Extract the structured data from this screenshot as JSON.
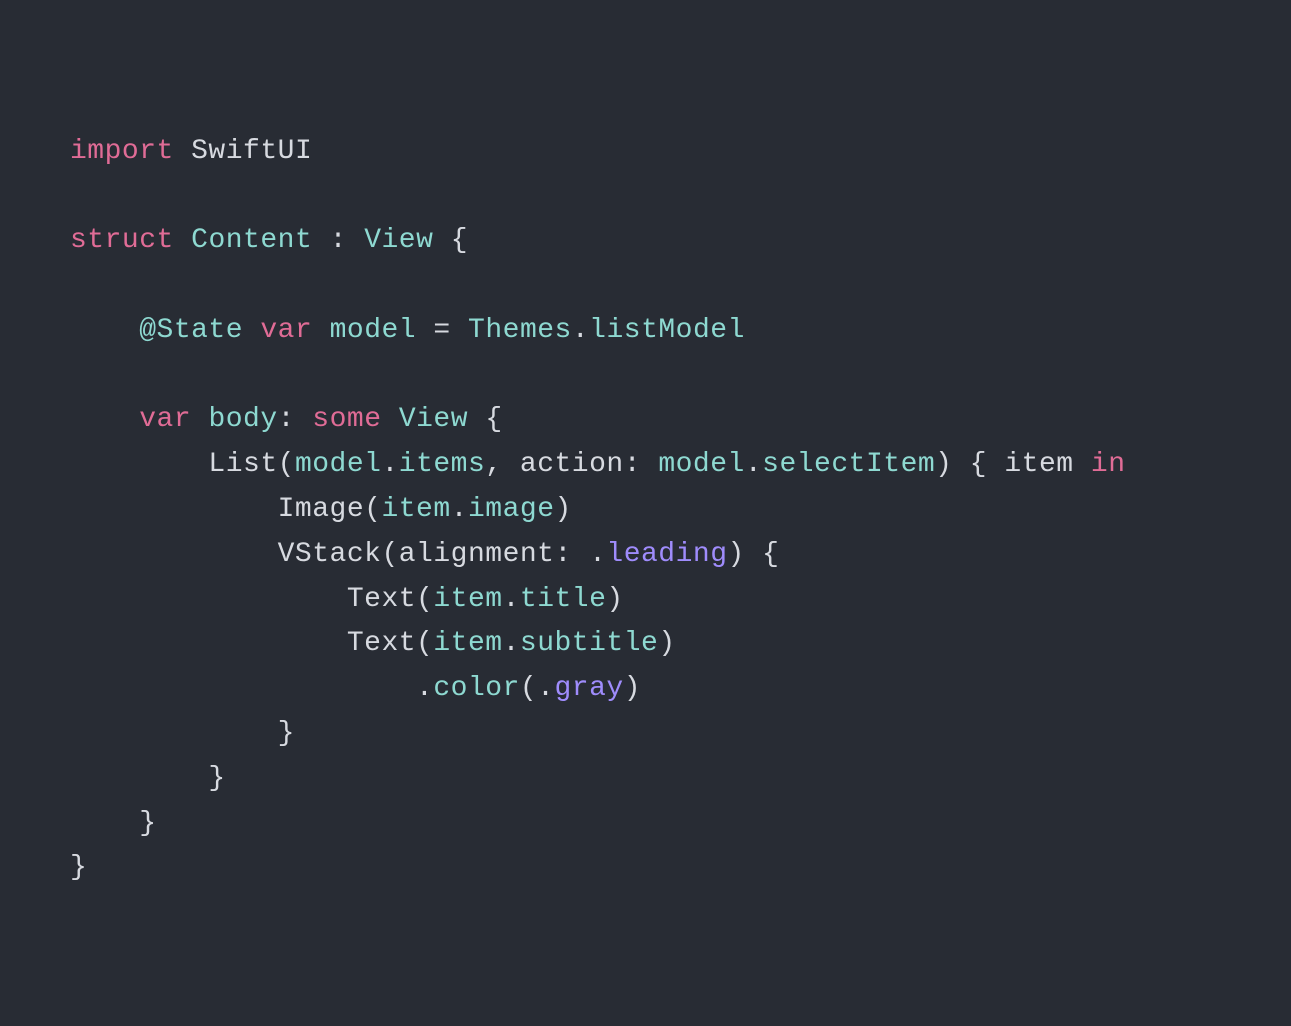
{
  "tokens": [
    [
      {
        "t": "import",
        "c": "keyword"
      },
      {
        "t": " SwiftUI",
        "c": "default"
      }
    ],
    [],
    [
      {
        "t": "struct",
        "c": "keyword"
      },
      {
        "t": " ",
        "c": "default"
      },
      {
        "t": "Content",
        "c": "type"
      },
      {
        "t": " : ",
        "c": "default"
      },
      {
        "t": "View",
        "c": "type"
      },
      {
        "t": " {",
        "c": "default"
      }
    ],
    [],
    [
      {
        "t": "    ",
        "c": "default"
      },
      {
        "t": "@State",
        "c": "type"
      },
      {
        "t": " ",
        "c": "default"
      },
      {
        "t": "var",
        "c": "keyword"
      },
      {
        "t": " ",
        "c": "default"
      },
      {
        "t": "model",
        "c": "property"
      },
      {
        "t": " = ",
        "c": "default"
      },
      {
        "t": "Themes",
        "c": "type"
      },
      {
        "t": ".",
        "c": "default"
      },
      {
        "t": "listModel",
        "c": "property"
      }
    ],
    [],
    [
      {
        "t": "    ",
        "c": "default"
      },
      {
        "t": "var",
        "c": "keyword"
      },
      {
        "t": " ",
        "c": "default"
      },
      {
        "t": "body",
        "c": "property"
      },
      {
        "t": ": ",
        "c": "default"
      },
      {
        "t": "some",
        "c": "keyword"
      },
      {
        "t": " ",
        "c": "default"
      },
      {
        "t": "View",
        "c": "type"
      },
      {
        "t": " {",
        "c": "default"
      }
    ],
    [
      {
        "t": "        List(",
        "c": "default"
      },
      {
        "t": "model",
        "c": "param"
      },
      {
        "t": ".",
        "c": "default"
      },
      {
        "t": "items",
        "c": "property"
      },
      {
        "t": ", action: ",
        "c": "default"
      },
      {
        "t": "model",
        "c": "param"
      },
      {
        "t": ".",
        "c": "default"
      },
      {
        "t": "selectItem",
        "c": "property"
      },
      {
        "t": ") { item ",
        "c": "default"
      },
      {
        "t": "in",
        "c": "keyword"
      }
    ],
    [
      {
        "t": "            Image(",
        "c": "default"
      },
      {
        "t": "item",
        "c": "param"
      },
      {
        "t": ".",
        "c": "default"
      },
      {
        "t": "image",
        "c": "property"
      },
      {
        "t": ")",
        "c": "default"
      }
    ],
    [
      {
        "t": "            VStack(alignment: .",
        "c": "default"
      },
      {
        "t": "leading",
        "c": "enum"
      },
      {
        "t": ") {",
        "c": "default"
      }
    ],
    [
      {
        "t": "                Text(",
        "c": "default"
      },
      {
        "t": "item",
        "c": "param"
      },
      {
        "t": ".",
        "c": "default"
      },
      {
        "t": "title",
        "c": "property"
      },
      {
        "t": ")",
        "c": "default"
      }
    ],
    [
      {
        "t": "                Text(",
        "c": "default"
      },
      {
        "t": "item",
        "c": "param"
      },
      {
        "t": ".",
        "c": "default"
      },
      {
        "t": "subtitle",
        "c": "property"
      },
      {
        "t": ")",
        "c": "default"
      }
    ],
    [
      {
        "t": "                    .",
        "c": "default"
      },
      {
        "t": "color",
        "c": "property"
      },
      {
        "t": "(.",
        "c": "default"
      },
      {
        "t": "gray",
        "c": "enum"
      },
      {
        "t": ")",
        "c": "default"
      }
    ],
    [
      {
        "t": "            }",
        "c": "default"
      }
    ],
    [
      {
        "t": "        }",
        "c": "default"
      }
    ],
    [
      {
        "t": "    }",
        "c": "default"
      }
    ],
    [
      {
        "t": "}",
        "c": "default"
      }
    ]
  ]
}
